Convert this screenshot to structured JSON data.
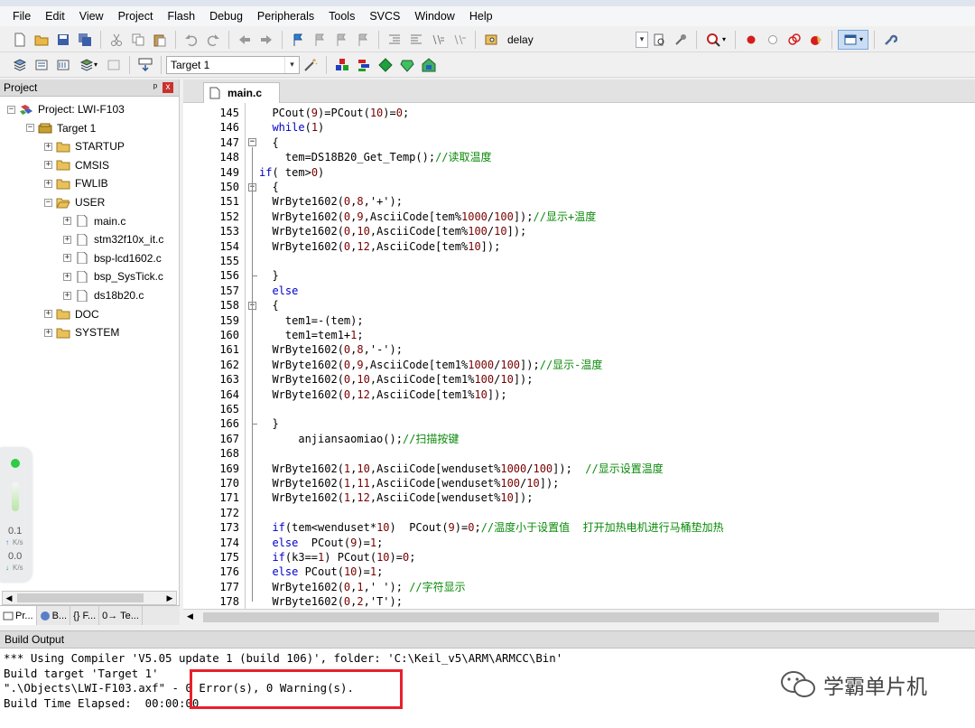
{
  "menu": [
    "File",
    "Edit",
    "View",
    "Project",
    "Flash",
    "Debug",
    "Peripherals",
    "Tools",
    "SVCS",
    "Window",
    "Help"
  ],
  "toolbar1": {
    "find_text": "delay"
  },
  "toolbar2": {
    "target_select": "Target 1"
  },
  "project_panel": {
    "title": "Project",
    "pin_glyph": "ᵖ",
    "close_glyph": "x",
    "tree": [
      {
        "label": "Project: LWI-F103",
        "level": 0,
        "type": "project",
        "expander": "−"
      },
      {
        "label": "Target 1",
        "level": 1,
        "type": "target",
        "expander": "−"
      },
      {
        "label": "STARTUP",
        "level": 2,
        "type": "folder",
        "expander": "+"
      },
      {
        "label": "CMSIS",
        "level": 2,
        "type": "folder",
        "expander": "+"
      },
      {
        "label": "FWLIB",
        "level": 2,
        "type": "folder",
        "expander": "+"
      },
      {
        "label": "USER",
        "level": 2,
        "type": "folder-open",
        "expander": "−"
      },
      {
        "label": "main.c",
        "level": 3,
        "type": "file",
        "expander": "+"
      },
      {
        "label": "stm32f10x_it.c",
        "level": 3,
        "type": "file",
        "expander": "+"
      },
      {
        "label": "bsp-lcd1602.c",
        "level": 3,
        "type": "file",
        "expander": "+"
      },
      {
        "label": "bsp_SysTick.c",
        "level": 3,
        "type": "file",
        "expander": "+"
      },
      {
        "label": "ds18b20.c",
        "level": 3,
        "type": "file",
        "expander": "+"
      },
      {
        "label": "DOC",
        "level": 2,
        "type": "folder",
        "expander": "+"
      },
      {
        "label": "SYSTEM",
        "level": 2,
        "type": "folder",
        "expander": "+"
      }
    ],
    "tabs": [
      "Pr...",
      "B...",
      "{} F...",
      "0→ Te..."
    ]
  },
  "net_widget": {
    "up": "0.1",
    "down": "0.0",
    "unit": "K/s",
    "up_arrow": "↑",
    "down_arrow": "↓"
  },
  "editor": {
    "tab_label": "main.c",
    "lines": [
      {
        "n": "145",
        "code": "  PCout(9)=PCout(10)=0;"
      },
      {
        "n": "146",
        "code": "  while(1)"
      },
      {
        "n": "147",
        "code": "  {"
      },
      {
        "n": "148",
        "code": "    tem=DS18B20_Get_Temp();//读取温度"
      },
      {
        "n": "149",
        "code": "if( tem>0)"
      },
      {
        "n": "150",
        "code": "  {"
      },
      {
        "n": "151",
        "code": "  WrByte1602(0,8,'+');"
      },
      {
        "n": "152",
        "code": "  WrByte1602(0,9,AsciiCode[tem%1000/100]);//显示+温度"
      },
      {
        "n": "153",
        "code": "  WrByte1602(0,10,AsciiCode[tem%100/10]);"
      },
      {
        "n": "154",
        "code": "  WrByte1602(0,12,AsciiCode[tem%10]);"
      },
      {
        "n": "155",
        "code": ""
      },
      {
        "n": "156",
        "code": "  }"
      },
      {
        "n": "157",
        "code": "  else"
      },
      {
        "n": "158",
        "code": "  {"
      },
      {
        "n": "159",
        "code": "    tem1=-(tem);"
      },
      {
        "n": "160",
        "code": "    tem1=tem1+1;"
      },
      {
        "n": "161",
        "code": "  WrByte1602(0,8,'-');"
      },
      {
        "n": "162",
        "code": "  WrByte1602(0,9,AsciiCode[tem1%1000/100]);//显示-温度"
      },
      {
        "n": "163",
        "code": "  WrByte1602(0,10,AsciiCode[tem1%100/10]);"
      },
      {
        "n": "164",
        "code": "  WrByte1602(0,12,AsciiCode[tem1%10]);"
      },
      {
        "n": "165",
        "code": ""
      },
      {
        "n": "166",
        "code": "  }"
      },
      {
        "n": "167",
        "code": "      anjiansaomiao();//扫描按键"
      },
      {
        "n": "168",
        "code": ""
      },
      {
        "n": "169",
        "code": "  WrByte1602(1,10,AsciiCode[wenduset%1000/100]);  //显示设置温度"
      },
      {
        "n": "170",
        "code": "  WrByte1602(1,11,AsciiCode[wenduset%100/10]);"
      },
      {
        "n": "171",
        "code": "  WrByte1602(1,12,AsciiCode[wenduset%10]);"
      },
      {
        "n": "172",
        "code": ""
      },
      {
        "n": "173",
        "code": "  if(tem<wenduset*10)  PCout(9)=0;//温度小于设置值  打开加热电机进行马桶垫加热"
      },
      {
        "n": "174",
        "code": "  else  PCout(9)=1;"
      },
      {
        "n": "175",
        "code": "  if(k3==1) PCout(10)=0;"
      },
      {
        "n": "176",
        "code": "  else PCout(10)=1;"
      },
      {
        "n": "177",
        "code": "  WrByte1602(0,1,' '); //字符显示"
      },
      {
        "n": "178",
        "code": "  WrByte1602(0,2,'T');"
      }
    ]
  },
  "build_output": {
    "title": "Build Output",
    "lines": [
      "*** Using Compiler 'V5.05 update 1 (build 106)', folder: 'C:\\Keil_v5\\ARM\\ARMCC\\Bin'",
      "Build target 'Target 1'",
      "\".\\Objects\\LWI-F103.axf\" - 0 Error(s), 0 Warning(s).",
      "Build Time Elapsed:  00:00:00"
    ]
  },
  "watermark": {
    "text": "学霸单片机"
  },
  "colors": {
    "keyword": "#0000c8",
    "comment": "#0a8a0a",
    "highlight_box": "#e8202a"
  }
}
